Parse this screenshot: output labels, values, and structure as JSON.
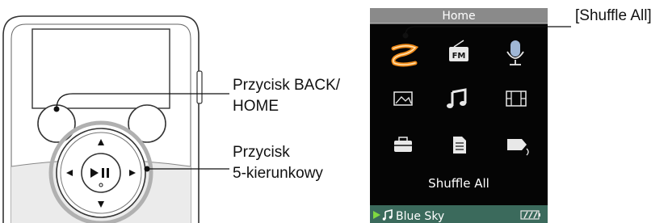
{
  "callouts": {
    "back_home": [
      "Przycisk BACK/",
      "HOME"
    ],
    "five_way": [
      "Przycisk",
      "5-kierunkowy"
    ],
    "shuffle_all": "[Shuffle All]"
  },
  "screen": {
    "title": "Home",
    "selected_label": "Shuffle All",
    "now_playing": "Blue Sky",
    "icons": [
      "shuffle-all-icon",
      "fm-radio-icon",
      "microphone-icon",
      "photo-icon",
      "music-note-icon",
      "video-film-icon",
      "settings-toolbox-icon",
      "playlist-document-icon",
      "now-playing-icon"
    ],
    "fm_text": "FM"
  },
  "colors": {
    "screen_bg": "#050505",
    "header_bg": "#8a8a8a",
    "selection": "#f08a18",
    "status_bar_bg": "#3b6a5c",
    "play_indicator": "#7fd840"
  }
}
